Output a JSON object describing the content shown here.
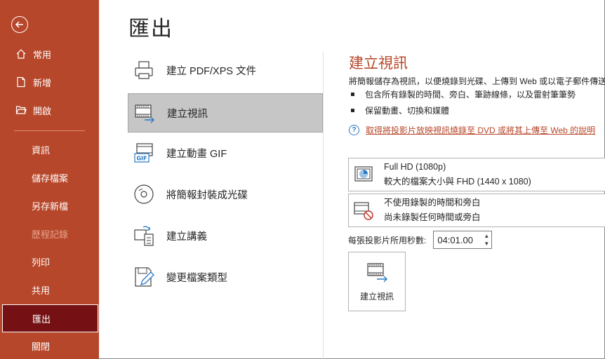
{
  "sidebar": {
    "back_label": "",
    "items": [
      {
        "label": "常用",
        "icon": "home-icon"
      },
      {
        "label": "新增",
        "icon": "new-file-icon"
      },
      {
        "label": "開啟",
        "icon": "folder-icon"
      },
      {
        "label": "資訊"
      },
      {
        "label": "儲存檔案"
      },
      {
        "label": "另存新檔"
      },
      {
        "label": "歷程記錄",
        "disabled": true
      },
      {
        "label": "列印"
      },
      {
        "label": "共用"
      },
      {
        "label": "匯出",
        "selected": true
      },
      {
        "label": "關閉"
      }
    ]
  },
  "page": {
    "title": "匯出"
  },
  "options": [
    {
      "label": "建立 PDF/XPS 文件",
      "icon": "pdf-printer-icon"
    },
    {
      "label": "建立視訊",
      "icon": "video-icon",
      "selected": true
    },
    {
      "label": "建立動畫 GIF",
      "icon": "gif-icon"
    },
    {
      "label": "將簡報封裝成光碟",
      "icon": "cd-icon"
    },
    {
      "label": "建立講義",
      "icon": "handouts-icon"
    },
    {
      "label": "變更檔案類型",
      "icon": "change-file-type-icon"
    }
  ],
  "panel": {
    "title": "建立視訊",
    "description": "將簡報儲存為視訊，以便燒錄到光碟、上傳到 Web 或以電子郵件傳送",
    "bullets": [
      "包含所有錄製的時間、旁白、筆跡線條，以及雷射筆筆勢",
      "保留動畫、切換和媒體"
    ],
    "help_link": "取得將投影片放映視訊燒錄至 DVD 或將其上傳至 Web 的說明",
    "quality": {
      "title": "Full HD (1080p)",
      "subtitle": "較大的檔案大小與 FHD (1440 x 1080)"
    },
    "timing": {
      "title": "不使用錄製的時間和旁白",
      "subtitle": "尚未錄製任何時間或旁白"
    },
    "seconds_label": "每張投影片所用秒數:",
    "seconds_value": "04:01.00",
    "create_button": "建立視訊"
  },
  "colors": {
    "accent": "#b7472a",
    "selected_nav": "#751114",
    "selected_option": "#c6c6c6"
  }
}
